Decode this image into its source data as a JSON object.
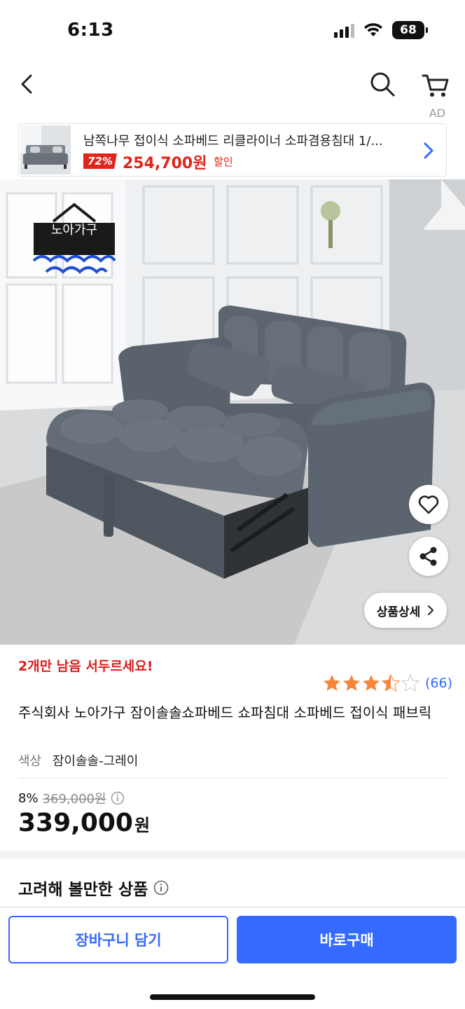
{
  "status_bar": {
    "time": "6:13",
    "battery": "68"
  },
  "ad": {
    "tag": "AD",
    "title": "남쪽나무 접이식 소파베드 리클라이너 소파겸용침대 1/...",
    "discount": "72%",
    "price": "254,700원",
    "sale_label": "할인"
  },
  "hero": {
    "brand_name": "노아가구",
    "detail_button": "상품상세"
  },
  "product": {
    "urgent_notice": "2개만 남음 서두르세요!",
    "rating": 4.5,
    "review_count": "(66)",
    "name": "주식회사 노아가구 잠이솔솔쇼파베드 쇼파침대 소파베드 접이식 패브릭",
    "option_label": "색상",
    "option_value": "잠이솔솔-그레이",
    "discount_rate": "8%",
    "original_price": "369,000원",
    "final_price": "339,000",
    "currency": "원"
  },
  "section": {
    "consider_title": "고려해 볼만한 상품"
  },
  "actions": {
    "cart": "장바구니 담기",
    "buy": "바로구매"
  },
  "colors": {
    "accent": "#346aff",
    "sale_red": "#e1251b",
    "star": "#f7853a"
  }
}
